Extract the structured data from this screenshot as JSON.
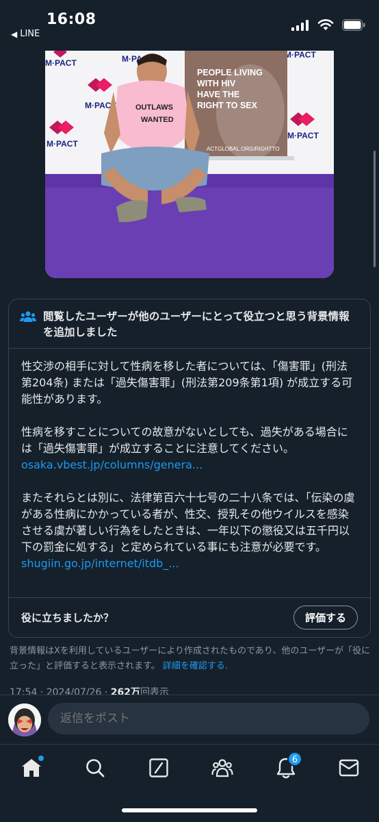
{
  "status": {
    "time": "16:08",
    "back_label": "LINE"
  },
  "photo": {
    "brand": "M·PACT",
    "poster_line": "PEOPLE LIVING WITH HIV HAVE THE RIGHT TO SEX",
    "poster_url": "ACTGLOBAL.ORG/RIGHTTO",
    "shirt_text": "OUTLAWS WANTED"
  },
  "note": {
    "title": "閲覧したユーザーが他のユーザーにとって役立つと思う背景情報を追加しました",
    "para1": "性交渉の相手に対して性病を移した者については、「傷害罪」(刑法第204条) または「過失傷害罪」(刑法第209条第1項) が成立する可能性があります。",
    "para2": "性病を移すことについての故意がないとしても、過失がある場合には「過失傷害罪」が成立することに注意してください。",
    "link1": "osaka.vbest.jp/columns/genera...",
    "para3": "またそれらとは別に、法律第百六十七号の二十八条では、「伝染の虞がある性病にかかっている者が、性交、授乳その他ウイルスを感染させる虞が著しい行為をしたときは、一年以下の懲役又は五千円以下の罰金に処する」と定められている事にも注意が必要です。",
    "link2": "shugiin.go.jp/internet/itdb_...",
    "helpful_question": "役に立ちましたか？",
    "rate_button": "評価する"
  },
  "disclaimer": {
    "text": "背景情報はXを利用しているユーザーにより作成されたものであり、他のユーザーが「役に立った」と評価すると表示されます。",
    "link": "詳細を確認する."
  },
  "meta": {
    "time": "17:54",
    "date": "2024/07/26",
    "views_count": "262万",
    "views_label": "回表示"
  },
  "reply": {
    "placeholder": "返信をポスト"
  },
  "nav": {
    "notifications_badge": "6"
  },
  "colors": {
    "background": "#15202b",
    "accent": "#1d9bf0",
    "border": "#38444d",
    "muted_text": "#8b98a5",
    "carpet": "#6a3fb3"
  }
}
